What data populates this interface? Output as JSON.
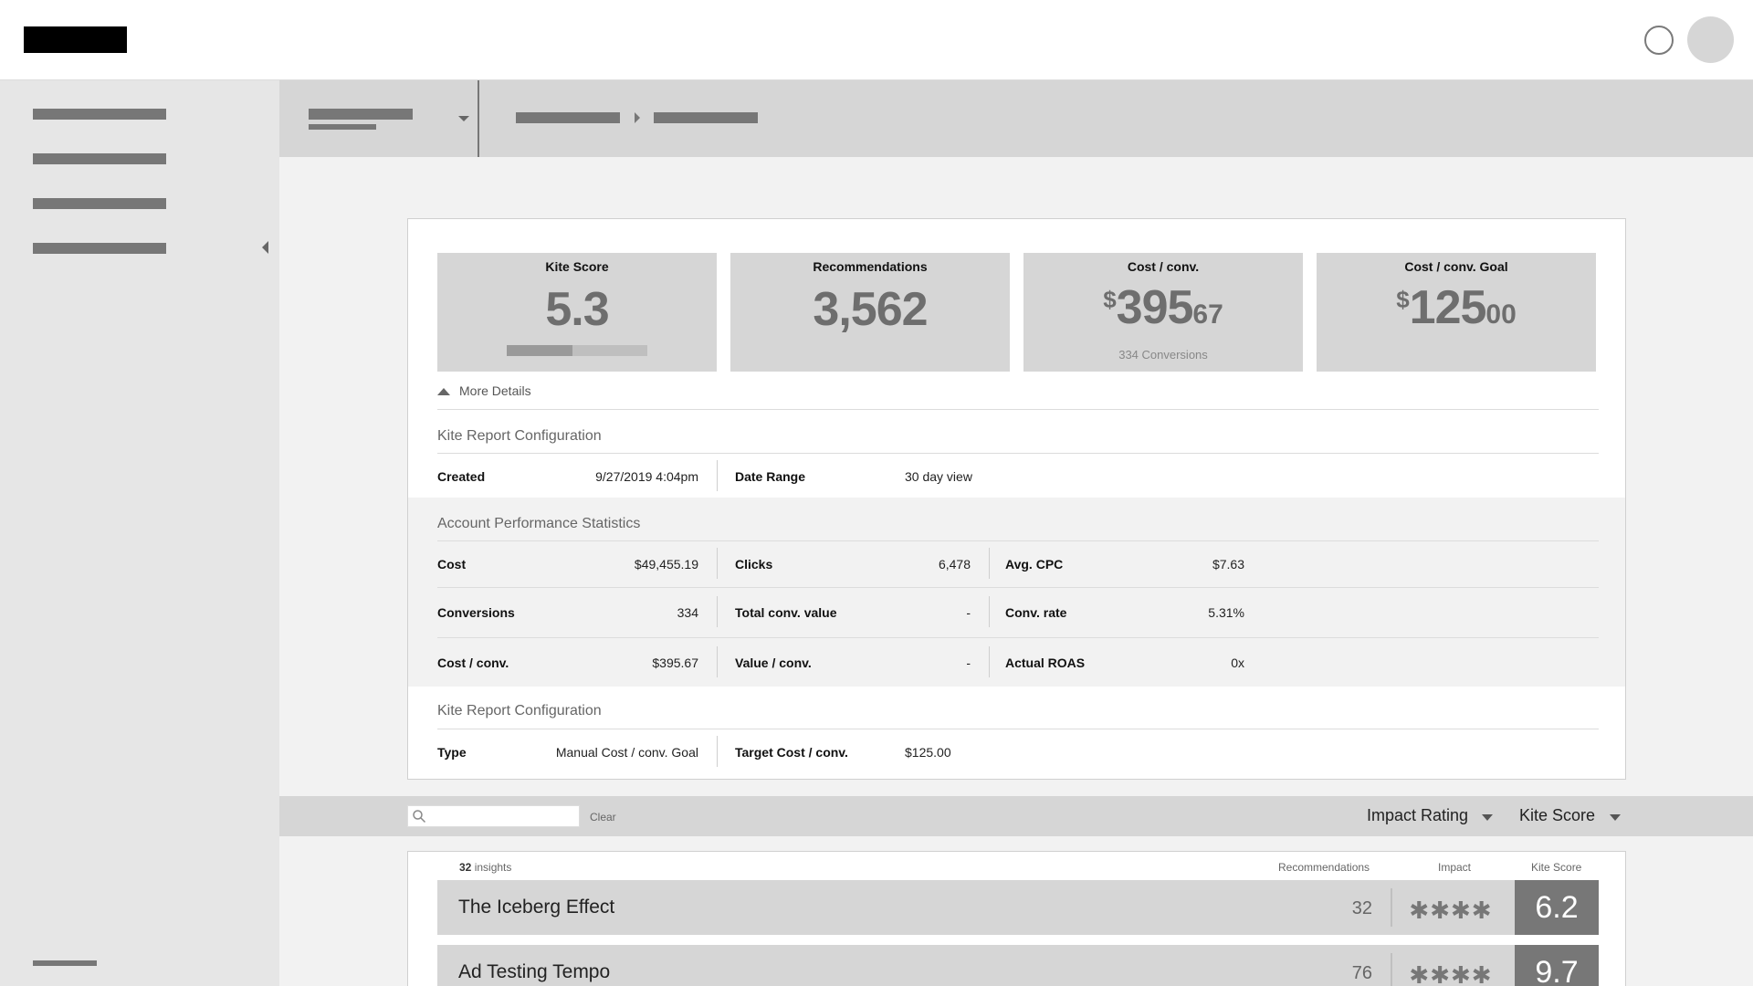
{
  "kpis": {
    "kite_score": {
      "title": "Kite Score",
      "value": "5.3",
      "progress": 0.47
    },
    "recommendations": {
      "title": "Recommendations",
      "value": "3,562"
    },
    "cost_conv": {
      "title": "Cost / conv.",
      "currency": "$",
      "whole": "395",
      "cents": "67",
      "sub": "334 Conversions"
    },
    "cost_conv_goal": {
      "title": "Cost / conv. Goal",
      "currency": "$",
      "whole": "125",
      "cents": "00"
    }
  },
  "more_details": "More Details",
  "config1": {
    "title": "Kite Report Configuration",
    "created_label": "Created",
    "created_value": "9/27/2019 4:04pm",
    "range_label": "Date Range",
    "range_value": "30 day view"
  },
  "stats": {
    "title": "Account Performance Statistics",
    "rows": [
      [
        {
          "label": "Cost",
          "value": "$49,455.19"
        },
        {
          "label": "Clicks",
          "value": "6,478"
        },
        {
          "label": "Avg. CPC",
          "value": "$7.63"
        }
      ],
      [
        {
          "label": "Conversions",
          "value": "334"
        },
        {
          "label": "Total conv. value",
          "value": "-"
        },
        {
          "label": "Conv. rate",
          "value": "5.31%"
        }
      ],
      [
        {
          "label": "Cost / conv.",
          "value": "$395.67"
        },
        {
          "label": "Value / conv.",
          "value": "-"
        },
        {
          "label": "Actual ROAS",
          "value": "0x"
        }
      ]
    ]
  },
  "config2": {
    "title": "Kite Report Configuration",
    "type_label": "Type",
    "type_value": "Manual Cost / conv. Goal",
    "target_label": "Target Cost / conv.",
    "target_value": "$125.00"
  },
  "filter": {
    "search_placeholder": "",
    "clear": "Clear",
    "impact_dropdown": "Impact Rating",
    "score_dropdown": "Kite Score"
  },
  "list": {
    "count": "32",
    "count_suffix": " insights",
    "col_recommendations": "Recommendations",
    "col_impact": "Impact",
    "col_score": "Kite Score",
    "rows": [
      {
        "title": "The Iceberg Effect",
        "recs": "32",
        "impact": "✱✱✱✱",
        "score": "6.2"
      },
      {
        "title": "Ad Testing Tempo",
        "recs": "76",
        "impact": "✱✱✱✱",
        "score": "9.7"
      }
    ]
  }
}
